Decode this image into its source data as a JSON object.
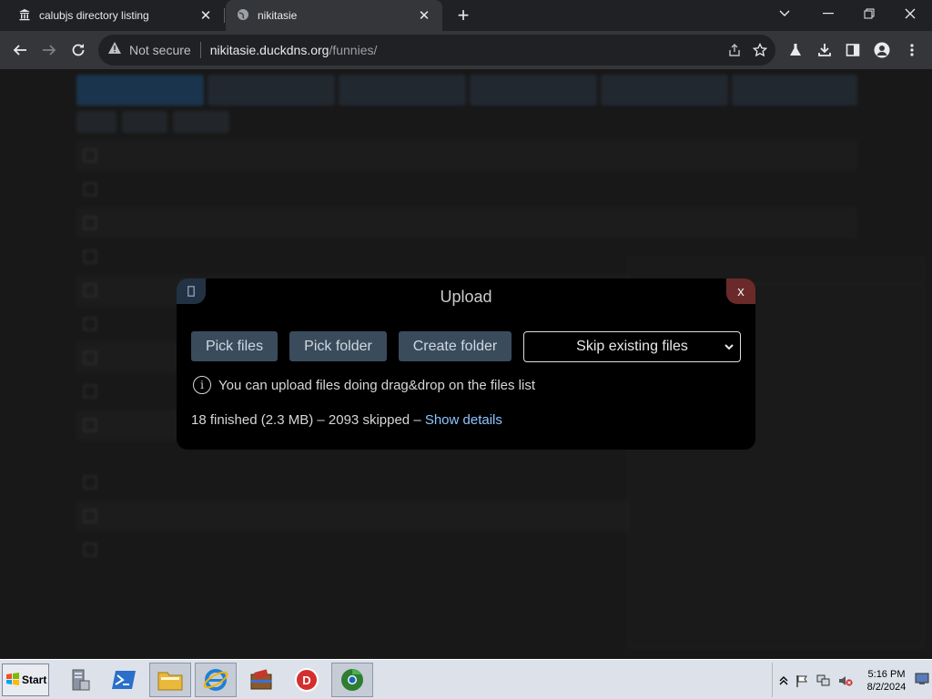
{
  "browser": {
    "tabs": [
      {
        "title": "calubjs directory listing",
        "icon": "bank-icon",
        "active": false
      },
      {
        "title": "nikitasie",
        "icon": "globe-icon",
        "active": true
      }
    ],
    "address": {
      "security_label": "Not secure",
      "host": "nikitasie.duckdns.org",
      "path": "/funnies/"
    }
  },
  "modal": {
    "title": "Upload",
    "close_label": "x",
    "buttons": {
      "pick_files": "Pick files",
      "pick_folder": "Pick folder",
      "create_folder": "Create folder"
    },
    "select": {
      "value": "Skip existing files"
    },
    "info_text": "You can upload files doing drag&drop on the files list",
    "status": {
      "text": "18 finished (2.3 MB) – 2093 skipped – ",
      "link": "Show details"
    }
  },
  "taskbar": {
    "start_label": "Start",
    "clock": {
      "time": "5:16 PM",
      "date": "8/2/2024"
    }
  },
  "colors": {
    "modal_bg": "#000000",
    "button_bg": "#3a4b5c",
    "close_bg": "#6b2a2a",
    "link": "#8ec5ff"
  }
}
